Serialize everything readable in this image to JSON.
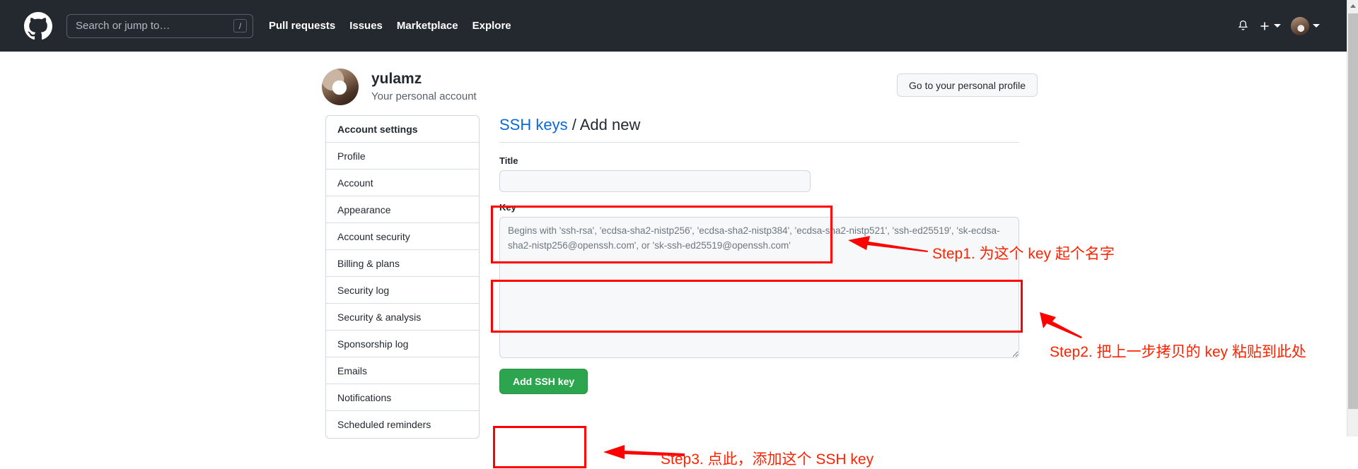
{
  "header": {
    "logo_icon": "github-mark-icon",
    "search": {
      "placeholder": "Search or jump to…",
      "shortcut_badge": "/",
      "value": ""
    },
    "nav": [
      {
        "label": "Pull requests"
      },
      {
        "label": "Issues"
      },
      {
        "label": "Marketplace"
      },
      {
        "label": "Explore"
      }
    ],
    "right": {
      "notifications_icon": "bell-icon",
      "create_new_icon": "plus-icon",
      "create_new_caret_icon": "chevron-down-icon",
      "avatar_icon": "user-avatar-icon",
      "avatar_caret_icon": "chevron-down-icon"
    }
  },
  "profile": {
    "avatar_icon": "user-avatar-icon",
    "username": "yulamz",
    "subtitle": "Your personal account",
    "goto_profile_label": "Go to your personal profile"
  },
  "sidebar": {
    "items": [
      {
        "label": "Account settings",
        "heading": true
      },
      {
        "label": "Profile",
        "heading": false
      },
      {
        "label": "Account",
        "heading": false
      },
      {
        "label": "Appearance",
        "heading": false
      },
      {
        "label": "Account security",
        "heading": false
      },
      {
        "label": "Billing & plans",
        "heading": false
      },
      {
        "label": "Security log",
        "heading": false
      },
      {
        "label": "Security & analysis",
        "heading": false
      },
      {
        "label": "Sponsorship log",
        "heading": false
      },
      {
        "label": "Emails",
        "heading": false
      },
      {
        "label": "Notifications",
        "heading": false
      },
      {
        "label": "Scheduled reminders",
        "heading": false
      }
    ]
  },
  "main": {
    "breadcrumb_link": "SSH keys",
    "breadcrumb_separator": "/",
    "breadcrumb_current": "Add new",
    "title_field": {
      "label": "Title",
      "value": "",
      "placeholder": ""
    },
    "key_field": {
      "label": "Key",
      "value": "",
      "placeholder": "Begins with 'ssh-rsa', 'ecdsa-sha2-nistp256', 'ecdsa-sha2-nistp384', 'ecdsa-sha2-nistp521', 'ssh-ed25519', 'sk-ecdsa-sha2-nistp256@openssh.com', or 'sk-ssh-ed25519@openssh.com'"
    },
    "submit_label": "Add SSH key"
  },
  "annotations": {
    "color": "#fe2200",
    "box_color": "#fe0000",
    "step1": "Step1. 为这个 key 起个名字",
    "step2": "Step2. 把上一步拷贝的 key 粘贴到此处",
    "step3": "Step3. 点此，添加这个 SSH key"
  },
  "colors": {
    "header_bg": "#24292f",
    "link_blue": "#0969da",
    "button_green": "#2da44e",
    "field_bg": "#f6f8fa",
    "border": "#d0d7de"
  },
  "scrollbar": {
    "up_arrow_icon": "triangle-up-icon"
  }
}
